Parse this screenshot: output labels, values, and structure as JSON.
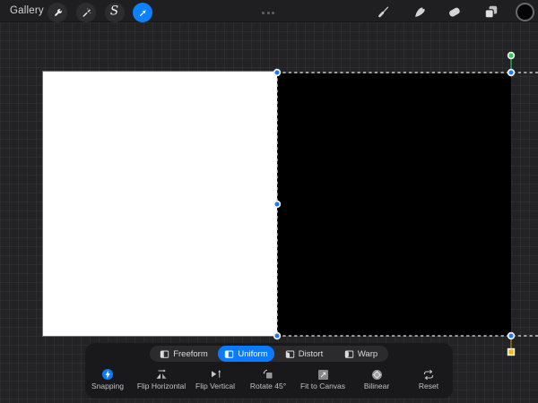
{
  "topbar": {
    "gallery_label": "Gallery",
    "selection_glyph": "S",
    "tools_left": [
      {
        "label": "Actions",
        "icon": "wrench-icon",
        "active": false
      },
      {
        "label": "Adjustments",
        "icon": "magic-wand-icon",
        "active": false
      },
      {
        "label": "Selection",
        "icon": "selection-s-icon",
        "active": false
      },
      {
        "label": "Transform",
        "icon": "transform-arrow-icon",
        "active": true
      }
    ],
    "center_icon": "ellipsis-dots",
    "tools_right": [
      {
        "label": "Brush",
        "icon": "paint-brush-icon"
      },
      {
        "label": "Smudge",
        "icon": "smudge-finger-icon"
      },
      {
        "label": "Eraser",
        "icon": "eraser-icon"
      },
      {
        "label": "Layers",
        "icon": "layers-icon"
      },
      {
        "label": "Color",
        "icon": "color-well",
        "color": "#000000"
      }
    ]
  },
  "canvas": {
    "background_color": "#ffffff",
    "selected_layer_color": "#000000"
  },
  "selection": {
    "handle_blue": "#1d7bf8",
    "handle_green": "#2ecc5e",
    "handle_yellow": "#f7b500",
    "snapping_enabled": true
  },
  "panel": {
    "modes": [
      {
        "label": "Freeform",
        "selected": false
      },
      {
        "label": "Uniform",
        "selected": true
      },
      {
        "label": "Distort",
        "selected": false
      },
      {
        "label": "Warp",
        "selected": false
      }
    ],
    "selected_mode": "Uniform",
    "actions": [
      {
        "label": "Snapping",
        "active": true
      },
      {
        "label": "Flip Horizontal"
      },
      {
        "label": "Flip Vertical"
      },
      {
        "label": "Rotate 45°"
      },
      {
        "label": "Fit to Canvas"
      },
      {
        "label": "Bilinear"
      },
      {
        "label": "Reset"
      }
    ],
    "accent_color": "#0a7bff"
  }
}
